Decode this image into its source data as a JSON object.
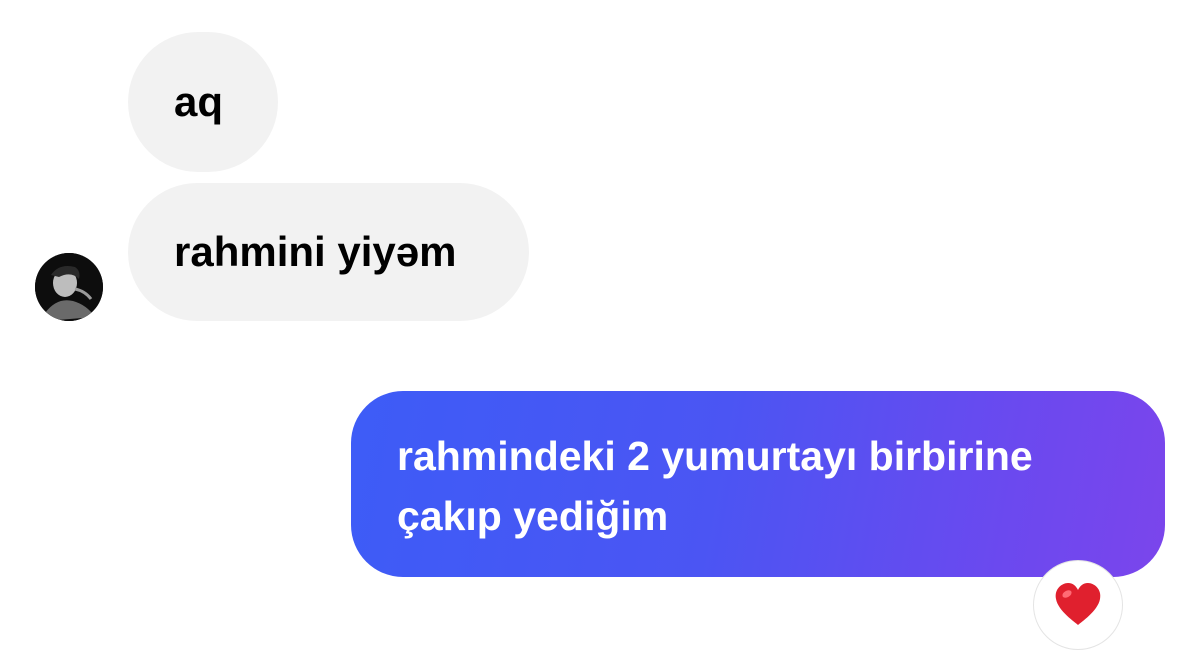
{
  "conversation": {
    "incoming": [
      {
        "text": "aq"
      },
      {
        "text": "rahmini yiyəm"
      }
    ],
    "outgoing": [
      {
        "lines": [
          "rahmindeki 2 yumurtayı birbirine",
          "çakıp yediğim"
        ]
      }
    ],
    "reaction": {
      "icon": "red-heart-icon",
      "color": "#e0202e"
    }
  },
  "colors": {
    "incoming_bubble": "#f2f2f2",
    "outgoing_gradient_start": "#3d5cf7",
    "outgoing_gradient_end": "#7b45ec"
  }
}
